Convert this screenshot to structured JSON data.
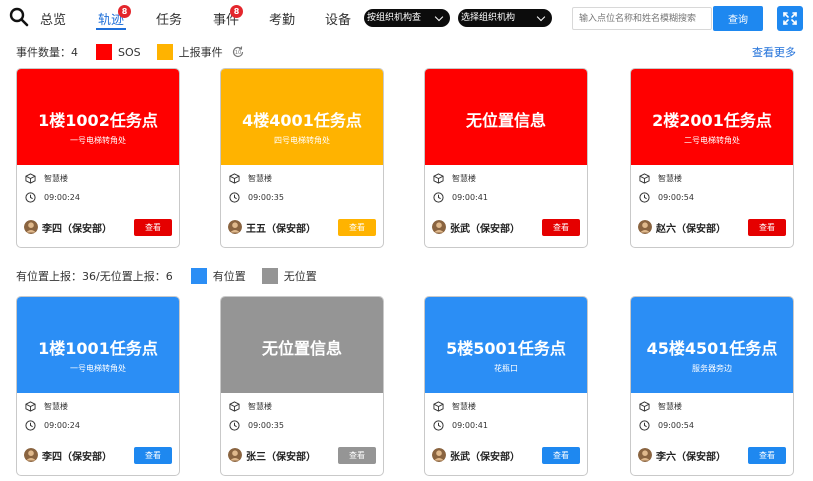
{
  "nav": {
    "items": [
      {
        "label": "总览"
      },
      {
        "label": "轨迹",
        "badge": "8"
      },
      {
        "label": "任务"
      },
      {
        "label": "事件",
        "badge": "8"
      },
      {
        "label": "考勤"
      },
      {
        "label": "设备"
      }
    ],
    "active": "轨迹",
    "org_filter_1": "按组织机构查",
    "org_filter_2": "选择组织机构",
    "search_placeholder": "输入点位名称和姓名模糊搜索",
    "search_button": "查询"
  },
  "colors": {
    "sos": "#ff0000",
    "report": "#ffb300",
    "has_location": "#2b8ef5",
    "no_location": "#959595",
    "accent": "#1e88f0"
  },
  "events": {
    "count_label": "事件数量：4",
    "legend_sos": "SOS",
    "legend_report": "上报事件",
    "view_more": "查看更多",
    "cards": [
      {
        "title": "1楼1002任务点",
        "subtitle": "一号电梯转角处",
        "building": "智慧楼",
        "time": "09:00:24",
        "person": "李四（保安部）",
        "action": "查看",
        "color": "#ff0000",
        "button_color": "#e50000"
      },
      {
        "title": "4楼4001任务点",
        "subtitle": "四号电梯转角处",
        "building": "智慧楼",
        "time": "09:00:35",
        "person": "王五（保安部）",
        "action": "查看",
        "color": "#ffb300",
        "button_color": "#ffb300"
      },
      {
        "title": "无位置信息",
        "subtitle": "",
        "building": "智慧楼",
        "time": "09:00:41",
        "person": "张武（保安部）",
        "action": "查看",
        "color": "#ff0000",
        "button_color": "#e50000"
      },
      {
        "title": "2楼2001任务点",
        "subtitle": "二号电梯转角处",
        "building": "智慧楼",
        "time": "09:00:54",
        "person": "赵六（保安部）",
        "action": "查看",
        "color": "#ff0000",
        "button_color": "#e50000"
      }
    ]
  },
  "locations": {
    "count_label": "有位置上报：36/无位置上报：6",
    "legend_has": "有位置",
    "legend_none": "无位置",
    "cards": [
      {
        "title": "1楼1001任务点",
        "subtitle": "一号电梯转角处",
        "building": "智慧楼",
        "time": "09:00:24",
        "person": "李四（保安部）",
        "action": "查看",
        "color": "#2b8ef5",
        "button_color": "#1e88f0"
      },
      {
        "title": "无位置信息",
        "subtitle": "",
        "building": "智慧楼",
        "time": "09:00:35",
        "person": "张三（保安部）",
        "action": "查看",
        "color": "#959595",
        "button_color": "#959595"
      },
      {
        "title": "5楼5001任务点",
        "subtitle": "花瓶口",
        "building": "智慧楼",
        "time": "09:00:41",
        "person": "张武（保安部）",
        "action": "查看",
        "color": "#2b8ef5",
        "button_color": "#1e88f0"
      },
      {
        "title": "45楼4501任务点",
        "subtitle": "服务器旁边",
        "building": "智慧楼",
        "time": "09:00:54",
        "person": "李六（保安部）",
        "action": "查看",
        "color": "#2b8ef5",
        "button_color": "#1e88f0"
      }
    ]
  }
}
